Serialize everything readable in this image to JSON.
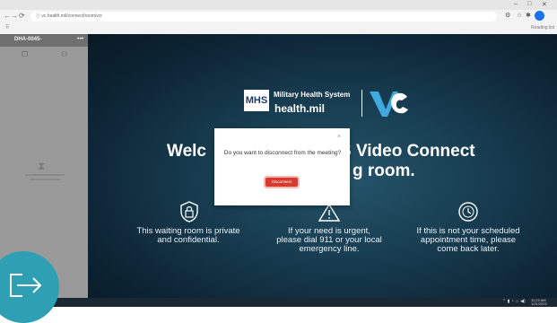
{
  "browser": {
    "url": "vc.health.mil/connect/room/vcr",
    "window_controls": [
      "–",
      "□",
      "✕"
    ],
    "nav": {
      "back": "←",
      "forward": "→",
      "reload": "⟳",
      "info": "ⓘ"
    },
    "bookmark_right": "Reading list"
  },
  "sidebar": {
    "title": "DHA-0045-",
    "menu_icon": "more-icon",
    "icons": [
      "chat-icon",
      "participants-icon"
    ]
  },
  "hero": {
    "mhs_badge": "MHS",
    "org_name": "Military Health System",
    "domain": "health.mil",
    "welcome_left": "Welc",
    "welcome_right": "S Video Connect",
    "welcome_sub": "g room."
  },
  "info_items": [
    {
      "icon": "lock-shield-icon",
      "line1": "This waiting room is private",
      "line2": "and confidential."
    },
    {
      "icon": "warning-icon",
      "line1": "If your need is urgent,",
      "line2": "please dial 911 or your local",
      "line3": "emergency line."
    },
    {
      "icon": "clock-icon",
      "line1": "If this is not your scheduled",
      "line2": "appointment time, please",
      "line3": "come back later."
    }
  ],
  "modal": {
    "close": "×",
    "message": "Do you want to disconnect from the meeting?",
    "confirm_label": "Disconnect"
  },
  "taskbar": {
    "tray": "⌃ ▮ ◔ ☼ ◀)",
    "time": "11:24 AM",
    "date": "1/21/2022"
  },
  "colors": {
    "disconnect": "#d73a2f",
    "overlay": "#2f9fb4",
    "vc_logo": "#3fa9e0"
  }
}
